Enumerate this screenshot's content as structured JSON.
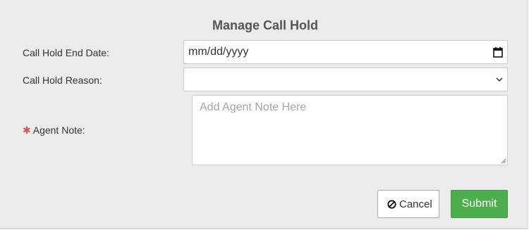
{
  "form": {
    "title": "Manage Call Hold",
    "end_date": {
      "label": "Call Hold End Date:",
      "value": "mm/dd/yyyy",
      "icon": "calendar-icon"
    },
    "reason": {
      "label": "Call Hold Reason:",
      "value": "",
      "icon": "chevron-down-icon"
    },
    "agent_note": {
      "label": "Agent Note:",
      "required_marker": "✱",
      "placeholder": "Add Agent Note Here",
      "value": ""
    }
  },
  "actions": {
    "cancel_label": "Cancel",
    "cancel_icon": "ban-icon",
    "submit_label": "Submit"
  },
  "colors": {
    "panel_bg": "#ebebeb",
    "submit_bg": "#4cae4c",
    "required": "#d9534f"
  }
}
